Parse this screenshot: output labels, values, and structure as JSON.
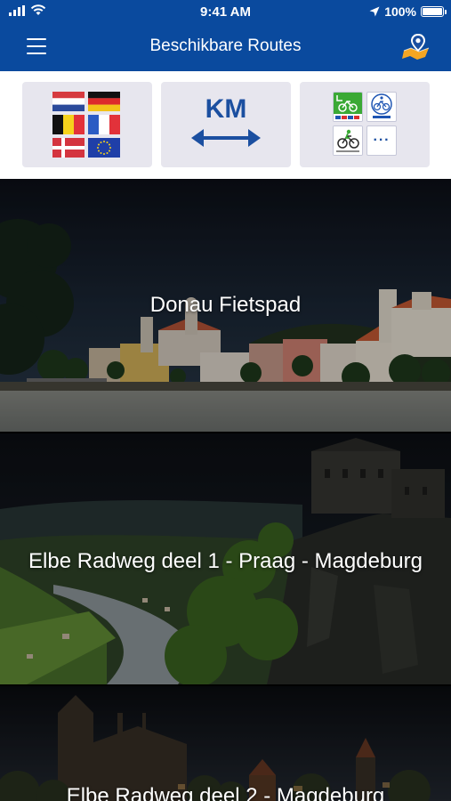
{
  "status_bar": {
    "time": "9:41 AM",
    "battery": "100%",
    "battery_level": 1.0,
    "icons": [
      "signal-icon",
      "wifi-icon",
      "location-arrow-icon",
      "battery-icon"
    ]
  },
  "nav": {
    "title": "Beschikbare Routes",
    "left_icon": "hamburger-menu-icon",
    "right_icon": "map-pin-icon"
  },
  "filters": {
    "language": {
      "icon": "language-flags-icon",
      "flags": [
        "netherlands-flag",
        "germany-flag",
        "belgium-flag",
        "france-flag",
        "denmark-flag",
        "eu-flag"
      ]
    },
    "distance": {
      "label": "KM",
      "icon": "double-arrow-icon"
    },
    "route_type": {
      "icons": [
        "cycling-route-icon",
        "wadden-cycling-icon",
        "cycling-event-icon",
        "more-icon"
      ],
      "more_label": "···"
    }
  },
  "routes": [
    {
      "title": "Donau Fietspad"
    },
    {
      "title": "Elbe Radweg deel 1 - Praag - Magdeburg"
    },
    {
      "title": "Elbe Radweg deel 2 - Magdeburg"
    }
  ],
  "colors": {
    "header_bg": "#0a4a9e",
    "tile_bg": "#e7e6ee",
    "accent_blue": "#1b4fa0",
    "map_pin_orange": "#f5a623"
  }
}
